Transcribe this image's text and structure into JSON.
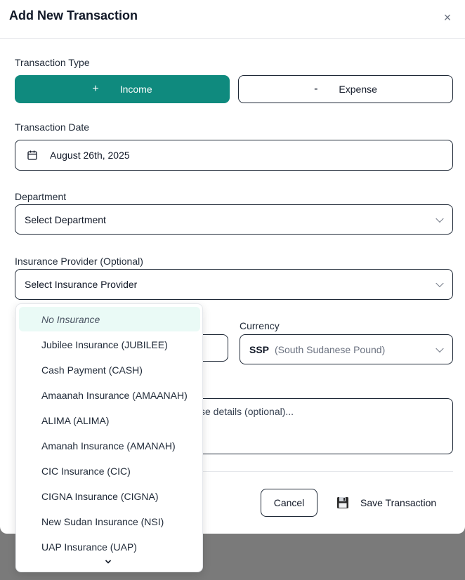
{
  "modal": {
    "title": "Add New Transaction",
    "close_symbol": "×"
  },
  "transaction_type": {
    "label": "Transaction Type",
    "income": {
      "symbol": "+",
      "label": "Income"
    },
    "expense": {
      "symbol": "-",
      "label": "Expense"
    }
  },
  "transaction_date": {
    "label": "Transaction Date",
    "value": "August 26th, 2025",
    "icon": "calendar-icon"
  },
  "department": {
    "label": "Department",
    "placeholder": "Select Department"
  },
  "insurance": {
    "label": "Insurance Provider (Optional)",
    "placeholder": "Select Insurance Provider",
    "options": [
      "No Insurance",
      "Jubilee Insurance (JUBILEE)",
      "Cash Payment (CASH)",
      "Amaanah Insurance (AMAANAH)",
      "ALIMA (ALIMA)",
      "Amanah Insurance (AMANAH)",
      "CIC Insurance (CIC)",
      "CIGNA Insurance (CIGNA)",
      "New Sudan Insurance (NSI)",
      "UAP Insurance (UAP)"
    ]
  },
  "currency": {
    "label": "Currency",
    "code": "SSP",
    "name": "(South Sudanese Pound)"
  },
  "description": {
    "visible_placeholder": "se details (optional)..."
  },
  "actions": {
    "cancel": "Cancel",
    "save": "Save Transaction",
    "save_icon": "floppy-disk-icon"
  },
  "colors": {
    "accent": "#0f8a7e",
    "selected_option_bg": "#eafaf6"
  }
}
